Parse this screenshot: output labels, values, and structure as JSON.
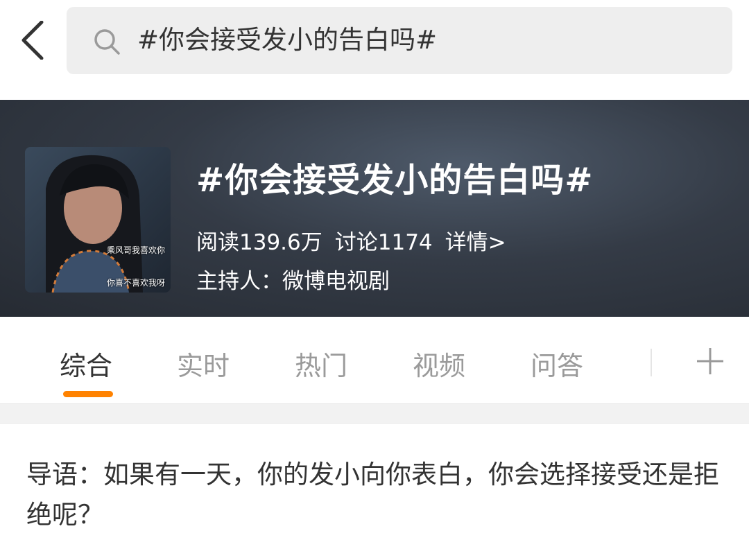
{
  "search": {
    "query": "#你会接受发小的告白吗#"
  },
  "topic": {
    "title": "#你会接受发小的告白吗#",
    "reads": "阅读139.6万",
    "discussions": "讨论1174",
    "details": "详情>",
    "host": "主持人：微博电视剧",
    "cover_caption_1": "乘风哥我喜欢你",
    "cover_caption_2": "你喜不喜欢我呀"
  },
  "tabs": [
    {
      "label": "综合",
      "active": true
    },
    {
      "label": "实时",
      "active": false
    },
    {
      "label": "热门",
      "active": false
    },
    {
      "label": "视频",
      "active": false
    },
    {
      "label": "问答",
      "active": false
    }
  ],
  "intro": {
    "text": "导语：如果有一天，你的发小向你表白，你会选择接受还是拒绝呢？"
  },
  "colors": {
    "accent": "#ff8200",
    "banner_dark": "#262b33",
    "search_bg": "#eeeeee"
  },
  "icons": [
    "back-arrow-icon",
    "search-icon",
    "plus-icon"
  ]
}
